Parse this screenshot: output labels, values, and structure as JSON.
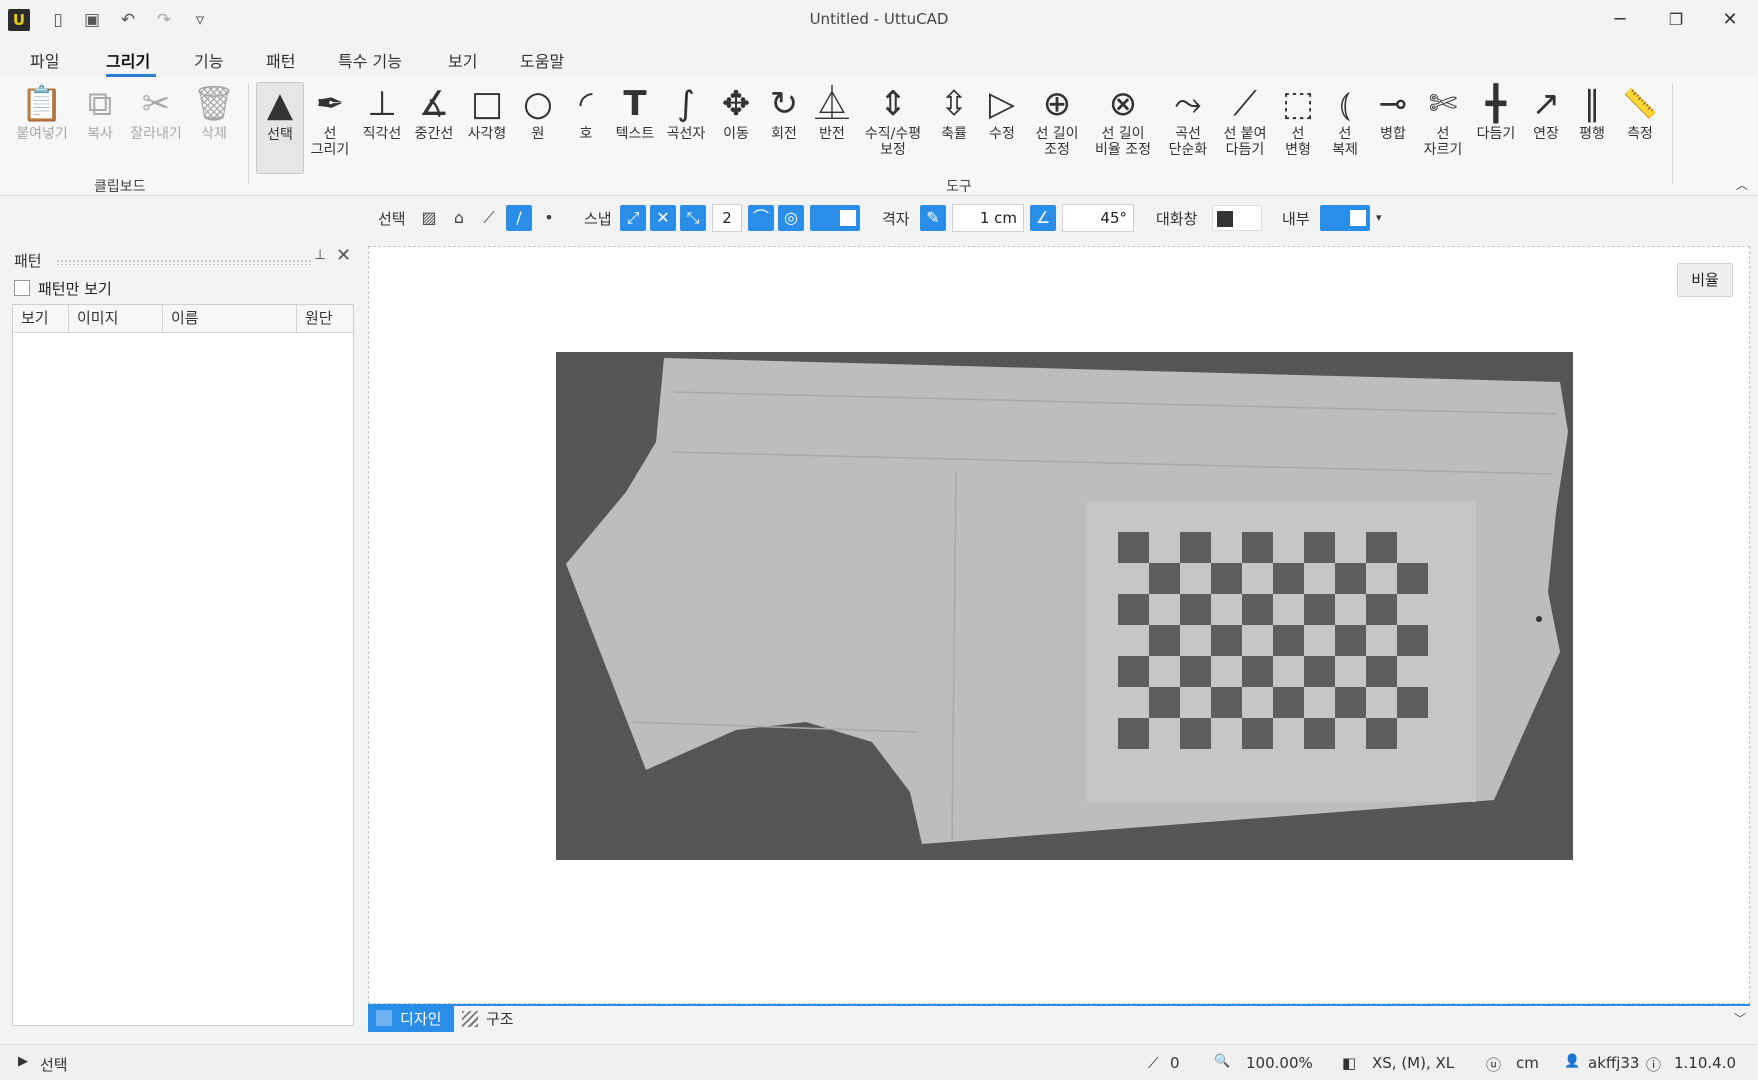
{
  "window": {
    "title": "Untitled - UttuCAD",
    "logo_letter": "U",
    "minimize": "─",
    "restore": "❐",
    "close": "✕"
  },
  "quick_access": {
    "new_icon": "▯",
    "save_icon": "▣",
    "undo_icon": "↶",
    "redo_icon": "↷",
    "customize_icon": "▿"
  },
  "menu": {
    "tabs": [
      {
        "label": "파일"
      },
      {
        "label": "그리기"
      },
      {
        "label": "기능"
      },
      {
        "label": "패턴"
      },
      {
        "label": "특수 기능"
      },
      {
        "label": "보기"
      },
      {
        "label": "도움말"
      }
    ],
    "active_index": 1
  },
  "ribbon": {
    "clipboard": {
      "group_label": "클립보드",
      "tools": [
        {
          "label": "붙여넣기",
          "icon": "📋"
        },
        {
          "label": "복사",
          "icon": "⧉"
        },
        {
          "label": "잘라내기",
          "icon": "✂"
        },
        {
          "label": "삭제",
          "icon": "🗑"
        }
      ]
    },
    "tools": {
      "group_label": "도구",
      "items": [
        {
          "label": "선택",
          "icon": "▲"
        },
        {
          "label": "선\n그리기",
          "icon": "✒"
        },
        {
          "label": "직각선",
          "icon": "⊥"
        },
        {
          "label": "중간선",
          "icon": "∡"
        },
        {
          "label": "사각형",
          "icon": "□"
        },
        {
          "label": "원",
          "icon": "○"
        },
        {
          "label": "호",
          "icon": "◜"
        },
        {
          "label": "텍스트",
          "icon": "T"
        },
        {
          "label": "곡선자",
          "icon": "∫"
        },
        {
          "label": "이동",
          "icon": "✥"
        },
        {
          "label": "회전",
          "icon": "↻"
        },
        {
          "label": "반전",
          "icon": "⏅"
        },
        {
          "label": "수직/수평\n보정",
          "icon": "⇕"
        },
        {
          "label": "축률",
          "icon": "⇳"
        },
        {
          "label": "수정",
          "icon": "▷"
        },
        {
          "label": "선 길이\n조정",
          "icon": "⊕"
        },
        {
          "label": "선 길이\n비율 조정",
          "icon": "⊗"
        },
        {
          "label": "곡선\n단순화",
          "icon": "⤳"
        },
        {
          "label": "선 붙여\n다듬기",
          "icon": "⟋"
        },
        {
          "label": "선\n변형",
          "icon": "⬚"
        },
        {
          "label": "선\n복제",
          "icon": "⦅"
        },
        {
          "label": "병합",
          "icon": "⊸"
        },
        {
          "label": "선\n자르기",
          "icon": "✄"
        },
        {
          "label": "다듬기",
          "icon": "╋"
        },
        {
          "label": "연장",
          "icon": "↗"
        },
        {
          "label": "평행",
          "icon": "∥"
        },
        {
          "label": "측정",
          "icon": "📏"
        }
      ]
    },
    "collapse_icon": "︿"
  },
  "options": {
    "select_label": "선택",
    "snap_label": "스냅",
    "snap_count": "2",
    "grid_label": "격자",
    "grid_size": "1 cm",
    "angle_value": "45°",
    "dialog_label": "대화창",
    "inner_label": "내부",
    "dropdown_icon": "▾",
    "icons": {
      "image": "▨",
      "bag": "⌂",
      "polyline": "⟋",
      "line": "/",
      "dot": "•",
      "snap_end": "⤢",
      "snap_cross": "✕",
      "snap_mid": "⤡",
      "snap_curve": "⌒",
      "snap_center": "◎",
      "grid_ruler": "✎",
      "angle": "∠"
    }
  },
  "panel": {
    "title": "패턴",
    "pin_icon": "⊥",
    "close_icon": "✕",
    "pattern_only_label": "패턴만 보기",
    "columns": [
      "보기",
      "이미지",
      "이름",
      "원단"
    ]
  },
  "canvas": {
    "zoom_fit_label": "비율"
  },
  "view_tabs": {
    "design_label": "디자인",
    "structure_label": "구조",
    "chevron": "﹀"
  },
  "status": {
    "mode_icon": "▶",
    "mode_label": "선택",
    "line_icon": "⟋",
    "line_count": "0",
    "zoom_icon": "🔍",
    "zoom": "100.00%",
    "size_icon": "◧",
    "sizes": "XS, (M), XL",
    "unit_icon": "ⓤ",
    "unit": "cm",
    "user_icon": "👤",
    "user": "akffj33",
    "info_icon": "ⓘ",
    "version": "1.10.4.0"
  },
  "colors": {
    "accent": "#2a8ee8",
    "image_bg": "#555555",
    "paper": "#bdbdbd"
  }
}
